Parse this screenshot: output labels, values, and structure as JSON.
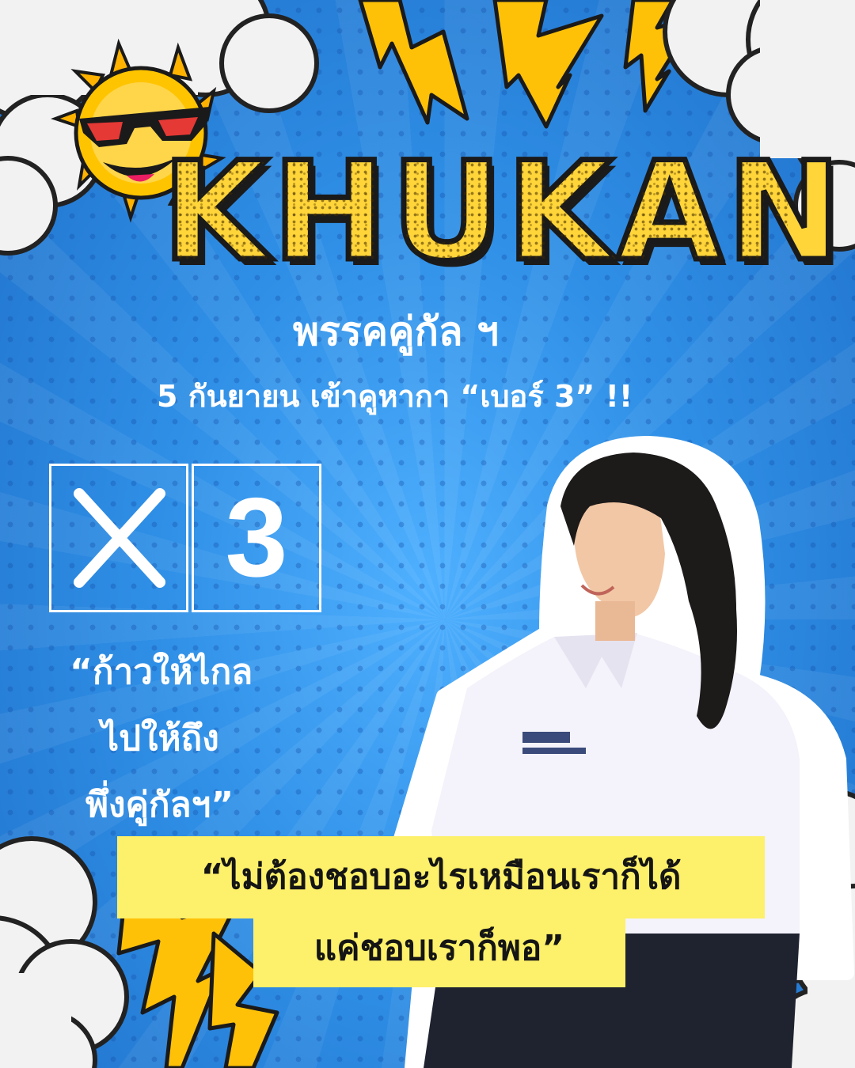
{
  "poster": {
    "title": "KHUKAN",
    "party_line": "พรรคคู่กัล ฯ",
    "date_line": "5 กันยายน เข้าคูหากา “เบอร์ 3” !!",
    "ballot": {
      "mark_icon": "x-mark-icon",
      "number": "3"
    },
    "slogan": [
      "“ก้าวให้ไกล",
      "ไปให้ถึง",
      "พึ่งคู่กัลฯ”"
    ],
    "quote": [
      "“ไม่ต้องชอบอะไรเหมือนเราก็ได้",
      "แค่ชอบเราก็พอ”"
    ],
    "colors": {
      "background": "#2f8fe6",
      "title": "#ffd53a",
      "lightning": "#ffc107",
      "highlight": "#fdf06a",
      "text": "#ffffff"
    },
    "icons": [
      "sun-with-sunglasses-icon",
      "lightning-bolt-icon",
      "cloud-icon",
      "candidate-photo"
    ]
  }
}
